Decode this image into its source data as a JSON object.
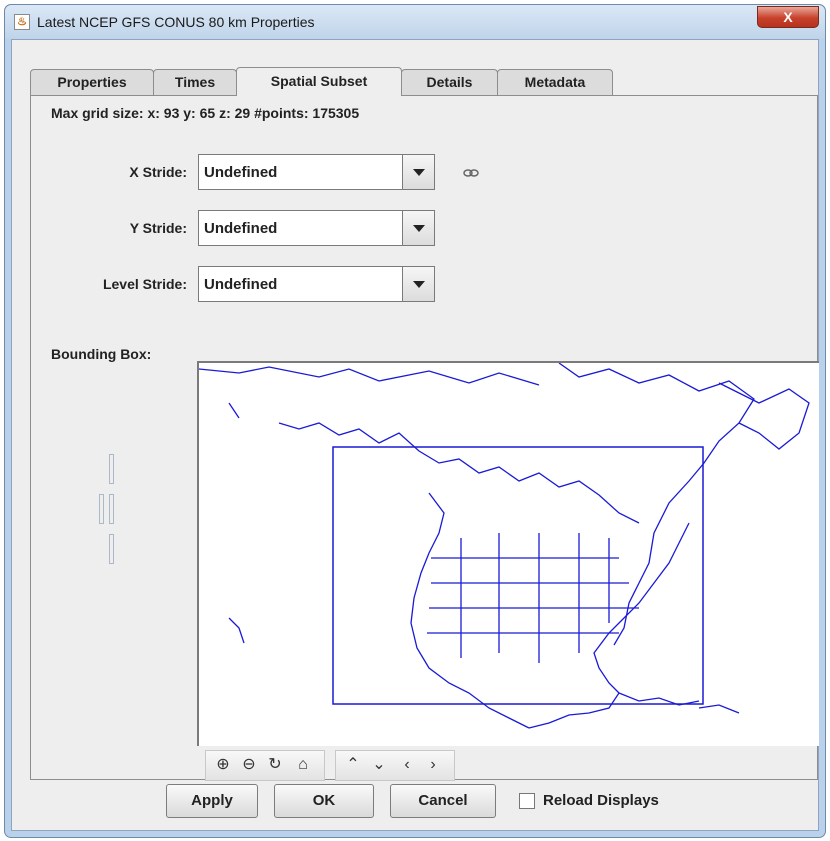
{
  "window": {
    "title": "Latest NCEP GFS CONUS 80 km Properties",
    "close_label": "X"
  },
  "tabs": [
    {
      "label": "Properties",
      "active": false
    },
    {
      "label": "Times",
      "active": false
    },
    {
      "label": "Spatial Subset",
      "active": true
    },
    {
      "label": "Details",
      "active": false
    },
    {
      "label": "Metadata",
      "active": false
    }
  ],
  "grid_info": "Max grid size: x: 93 y: 65 z: 29   #points: 175305",
  "strides": {
    "x": {
      "label": "X Stride:",
      "value": "Undefined"
    },
    "y": {
      "label": "Y Stride:",
      "value": "Undefined"
    },
    "level": {
      "label": "Level Stride:",
      "value": "Undefined"
    }
  },
  "bounding_box_label": "Bounding Box:",
  "map_toolbar": {
    "zoom_in_icon": "zoom-in-icon",
    "zoom_out_icon": "zoom-out-icon",
    "reset_icon": "rotate-reset-icon",
    "home_icon": "home-icon",
    "up_icon": "chevron-up-icon",
    "down_icon": "chevron-down-icon",
    "left_icon": "chevron-left-icon",
    "right_icon": "chevron-right-icon"
  },
  "buttons": {
    "apply": "Apply",
    "ok": "OK",
    "cancel": "Cancel"
  },
  "reload_displays": {
    "label": "Reload Displays",
    "checked": false
  },
  "colors": {
    "map_lines": "#1a1ad6",
    "window_frame": "#b9d1ea",
    "close_button": "#c7412b"
  }
}
